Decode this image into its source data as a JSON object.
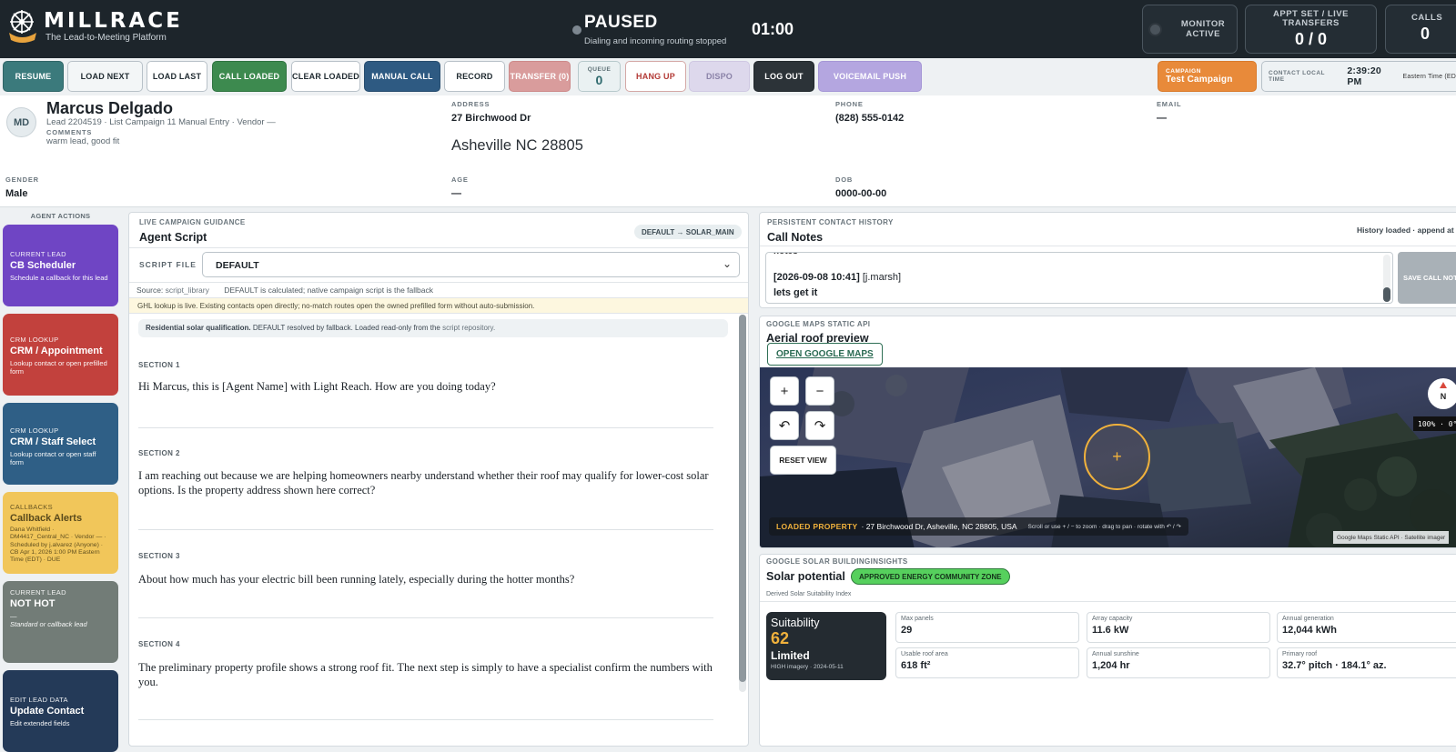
{
  "brand": {
    "name": "MILLRACE",
    "tagline": "The Lead-to-Meeting Platform"
  },
  "status": {
    "title": "PAUSED",
    "subtitle": "Dialing and incoming routing stopped",
    "timer": "01:00"
  },
  "top_cards": {
    "monitor": {
      "label": "MONITOR ACTIVE"
    },
    "appt": {
      "label": "APPT SET / LIVE TRANSFERS",
      "value": "0 / 0"
    },
    "calls": {
      "label": "CALLS",
      "value": "0"
    }
  },
  "toolbar": {
    "resume": "RESUME",
    "load_next": "LOAD NEXT",
    "load_last": "LOAD LAST",
    "call_loaded": "CALL LOADED",
    "clear_loaded": "CLEAR LOADED",
    "manual_call": "MANUAL CALL",
    "record": "RECORD",
    "transfer": "TRANSFER (0)",
    "queue_label": "QUEUE",
    "queue_value": "0",
    "hang_up": "HANG UP",
    "dispo": "DISPO",
    "log_out": "LOG OUT",
    "voicemail_push": "VOICEMAIL PUSH",
    "campaign_label": "CAMPAIGN",
    "campaign_value": "Test Campaign",
    "local_time_label": "CONTACT LOCAL TIME",
    "local_time_value": "2:39:20 PM",
    "local_time_zone": "Eastern Time (ED"
  },
  "lead": {
    "initials": "MD",
    "name": "Marcus Delgado",
    "meta": "Lead 2204519 · List Campaign 11 Manual Entry · Vendor —",
    "comments_label": "COMMENTS",
    "comments": "warm lead, good fit",
    "address_label": "ADDRESS",
    "address": "27 Birchwood Dr",
    "city_line": "Asheville NC 28805",
    "phone_label": "PHONE",
    "phone": "(828) 555-0142",
    "email_label": "EMAIL",
    "email": "—",
    "gender_label": "GENDER",
    "gender": "Male",
    "age_label": "AGE",
    "age": "—",
    "dob_label": "DOB",
    "dob": "0000-00-00"
  },
  "agent_actions": {
    "header": "AGENT ACTIONS",
    "items": [
      {
        "kicker": "CURRENT LEAD",
        "title": "CB Scheduler",
        "desc": "Schedule a callback for this lead",
        "color": "#6f45c4"
      },
      {
        "kicker": "CRM LOOKUP",
        "title": "CRM / Appointment",
        "desc": "Lookup contact or open prefilled form",
        "color": "#c2413d"
      },
      {
        "kicker": "CRM LOOKUP",
        "title": "CRM / Staff Select",
        "desc": "Lookup contact or open staff form",
        "color": "#2f5f86"
      },
      {
        "kicker": "CALLBACKS",
        "title": "Callback Alerts",
        "desc": "Dana Whitfield · DM4417_Central_NC · Vendor — · Scheduled by j.alvarez (Anyone) · CB Apr 1, 2026 1:00 PM Eastern Time (EDT) · DUE",
        "color": "#f1c65a"
      },
      {
        "kicker": "CURRENT LEAD",
        "title": "NOT HOT",
        "desc": "—",
        "desc2": "Standard or callback lead",
        "color": "#727c77"
      },
      {
        "kicker": "EDIT LEAD DATA",
        "title": "Update Contact",
        "desc": "Edit extended fields",
        "color": "#243a58"
      }
    ]
  },
  "script": {
    "kicker": "LIVE CAMPAIGN GUIDANCE",
    "title": "Agent Script",
    "route_badge": "DEFAULT → SOLAR_MAIN",
    "file_label": "SCRIPT FILE",
    "file_value": "DEFAULT",
    "source_prefix": "Source:",
    "source_value": "script_library",
    "source_note": "DEFAULT is calculated; native campaign script is the fallback",
    "ghl_notice": "GHL lookup is live. Existing contacts open directly; no-match routes open the owned prefilled form without auto-submission.",
    "info_bold": "Residential solar qualification.",
    "info_text": "DEFAULT resolved by fallback. Loaded read-only from the",
    "info_link": "script repository.",
    "sections": [
      {
        "label": "SECTION 1",
        "text": "Hi Marcus, this is [Agent Name] with Light Reach. How are you doing today?"
      },
      {
        "label": "SECTION 2",
        "text": "I am reaching out because we are helping homeowners nearby understand whether their roof may qualify for lower-cost solar options. Is the property address shown here correct?"
      },
      {
        "label": "SECTION 3",
        "text": "About how much has your electric bill been running lately, especially during the hotter months?"
      },
      {
        "label": "SECTION 4",
        "text": "The preliminary property profile shows a strong roof fit. The next step is simply to have a specialist confirm the numbers with you."
      }
    ]
  },
  "notes": {
    "kicker": "PERSISTENT CONTACT HISTORY",
    "title": "Call Notes",
    "status": "History loaded · append at e",
    "partial_line": "notes",
    "entry_stamp": "[2026-09-08 10:41]",
    "entry_user": "[j.marsh]",
    "entry_text": "lets get it",
    "save_button": "SAVE CALL NOTE"
  },
  "map": {
    "kicker": "GOOGLE MAPS STATIC API",
    "title": "Aerial roof preview",
    "open_button": "OPEN GOOGLE MAPS",
    "zoom_in": "+",
    "zoom_out": "−",
    "rotate_left": "↶",
    "rotate_right": "↷",
    "reset_view": "RESET VIEW",
    "compass": "N",
    "zoom_readout": "100% · 0°",
    "loaded_label": "LOADED PROPERTY",
    "loaded_address": "· 27 Birchwood Dr, Asheville, NC 28805, USA",
    "hint": "Scroll or use + / − to zoom · drag to pan · rotate with ↶ / ↷",
    "attribution": "Google Maps Static API · Satellite imager"
  },
  "solar": {
    "kicker": "GOOGLE SOLAR BUILDINGINSIGHTS",
    "title": "Solar potential",
    "zone_badge": "APPROVED ENERGY COMMUNITY ZONE",
    "sub": "Derived Solar Suitability Index",
    "suit_label": "Suitability",
    "suit_score": "62",
    "suit_rating": "Limited",
    "suit_meta": "HIGH imagery · 2024-05-11",
    "metrics": [
      {
        "label": "Max panels",
        "value": "29"
      },
      {
        "label": "Array capacity",
        "value": "11.6 kW"
      },
      {
        "label": "Annual generation",
        "value": "12,044 kWh"
      },
      {
        "label": "Usable roof area",
        "value": "618 ft²"
      },
      {
        "label": "Annual sunshine",
        "value": "1,204 hr"
      },
      {
        "label": "Primary roof",
        "value": "32.7° pitch · 184.1° az."
      }
    ]
  }
}
